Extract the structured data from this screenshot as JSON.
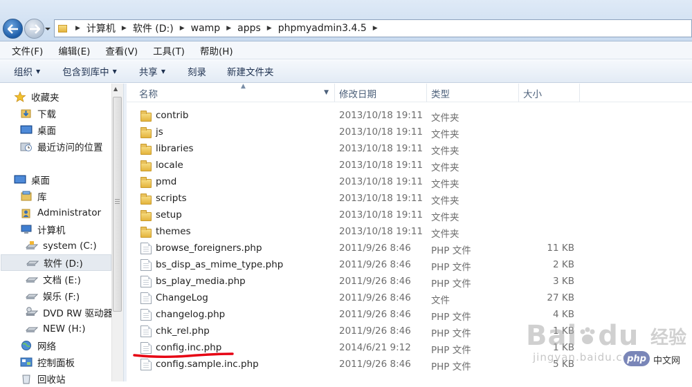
{
  "address": {
    "breadcrumbs": [
      "计算机",
      "软件 (D:)",
      "wamp",
      "apps",
      "phpmyadmin3.4.5"
    ]
  },
  "menu": [
    "文件(F)",
    "编辑(E)",
    "查看(V)",
    "工具(T)",
    "帮助(H)"
  ],
  "commands": [
    {
      "label": "组织",
      "dropdown": true
    },
    {
      "label": "包含到库中",
      "dropdown": true
    },
    {
      "label": "共享",
      "dropdown": true
    },
    {
      "label": "刻录",
      "dropdown": false
    },
    {
      "label": "新建文件夹",
      "dropdown": false
    }
  ],
  "nav": [
    {
      "label": "收藏夹",
      "icon": "star-icon"
    },
    {
      "label": "下载",
      "icon": "downloads-icon"
    },
    {
      "label": "桌面",
      "icon": "desktop-icon"
    },
    {
      "label": "最近访问的位置",
      "icon": "recent-places-icon"
    },
    {
      "label": "桌面",
      "icon": "desktop-icon"
    },
    {
      "label": "库",
      "icon": "library-icon"
    },
    {
      "label": "Administrator",
      "icon": "user-folder-icon"
    },
    {
      "label": "计算机",
      "icon": "computer-icon"
    },
    {
      "label": "system (C:)",
      "icon": "system-drive-icon"
    },
    {
      "label": "软件 (D:)",
      "icon": "drive-icon"
    },
    {
      "label": "文档 (E:)",
      "icon": "drive-icon"
    },
    {
      "label": "娱乐 (F:)",
      "icon": "drive-icon"
    },
    {
      "label": "DVD RW 驱动器",
      "icon": "dvd-drive-icon"
    },
    {
      "label": "NEW (H:)",
      "icon": "drive-icon"
    },
    {
      "label": "网络",
      "icon": "network-icon"
    },
    {
      "label": "控制面板",
      "icon": "control-panel-icon"
    },
    {
      "label": "回收站",
      "icon": "recycle-bin-icon"
    }
  ],
  "columns": {
    "name": "名称",
    "date": "修改日期",
    "type": "类型",
    "size": "大小"
  },
  "files": [
    {
      "name": "contrib",
      "date": "2013/10/18 19:11",
      "type": "文件夹",
      "size": "",
      "kind": "folder"
    },
    {
      "name": "js",
      "date": "2013/10/18 19:11",
      "type": "文件夹",
      "size": "",
      "kind": "folder"
    },
    {
      "name": "libraries",
      "date": "2013/10/18 19:11",
      "type": "文件夹",
      "size": "",
      "kind": "folder"
    },
    {
      "name": "locale",
      "date": "2013/10/18 19:11",
      "type": "文件夹",
      "size": "",
      "kind": "folder"
    },
    {
      "name": "pmd",
      "date": "2013/10/18 19:11",
      "type": "文件夹",
      "size": "",
      "kind": "folder"
    },
    {
      "name": "scripts",
      "date": "2013/10/18 19:11",
      "type": "文件夹",
      "size": "",
      "kind": "folder"
    },
    {
      "name": "setup",
      "date": "2013/10/18 19:11",
      "type": "文件夹",
      "size": "",
      "kind": "folder"
    },
    {
      "name": "themes",
      "date": "2013/10/18 19:11",
      "type": "文件夹",
      "size": "",
      "kind": "folder"
    },
    {
      "name": "browse_foreigners.php",
      "date": "2011/9/26 8:46",
      "type": "PHP 文件",
      "size": "11 KB",
      "kind": "file"
    },
    {
      "name": "bs_disp_as_mime_type.php",
      "date": "2011/9/26 8:46",
      "type": "PHP 文件",
      "size": "2 KB",
      "kind": "file"
    },
    {
      "name": "bs_play_media.php",
      "date": "2011/9/26 8:46",
      "type": "PHP 文件",
      "size": "3 KB",
      "kind": "file"
    },
    {
      "name": "ChangeLog",
      "date": "2011/9/26 8:46",
      "type": "文件",
      "size": "27 KB",
      "kind": "file"
    },
    {
      "name": "changelog.php",
      "date": "2011/9/26 8:46",
      "type": "PHP 文件",
      "size": "4 KB",
      "kind": "file"
    },
    {
      "name": "chk_rel.php",
      "date": "2011/9/26 8:46",
      "type": "PHP 文件",
      "size": "1 KB",
      "kind": "file"
    },
    {
      "name": "config.inc.php",
      "date": "2014/6/21 9:12",
      "type": "PHP 文件",
      "size": "1 KB",
      "kind": "file"
    },
    {
      "name": "config.sample.inc.php",
      "date": "2011/9/26 8:46",
      "type": "PHP 文件",
      "size": "5 KB",
      "kind": "file"
    }
  ],
  "watermark": {
    "brand": "Bai",
    "brand2": "du",
    "cn": "经验",
    "url": "jingyan.baidu.com"
  },
  "badge": {
    "logo": "php",
    "cn": "中文网"
  }
}
